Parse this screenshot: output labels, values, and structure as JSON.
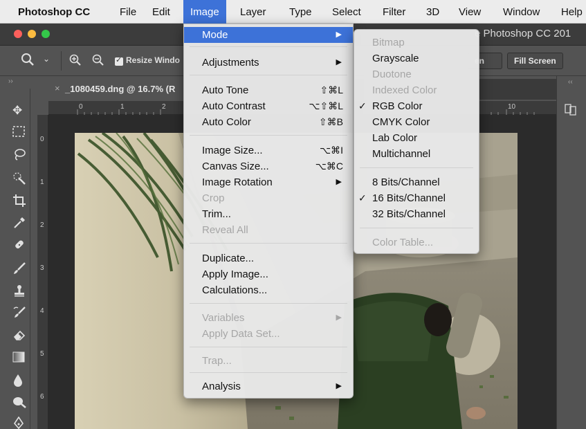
{
  "menubar": {
    "app": "Photoshop CC",
    "items": [
      "File",
      "Edit",
      "Image",
      "Layer",
      "Type",
      "Select",
      "Filter",
      "3D",
      "View",
      "Window",
      "Help"
    ]
  },
  "window": {
    "title": "e Photoshop CC 201"
  },
  "options_bar": {
    "resize_windows_label": "Resize Windo",
    "screen_button": "en",
    "fill_screen_button": "Fill Screen"
  },
  "document": {
    "tab_title": "_1080459.dng @ 16.7% (R"
  },
  "ruler": {
    "h": [
      "0",
      "1",
      "2",
      "10"
    ],
    "v": [
      "0",
      "1",
      "2",
      "3",
      "4",
      "5",
      "6"
    ]
  },
  "image_menu": {
    "mode": "Mode",
    "adjustments": "Adjustments",
    "auto_tone": "Auto Tone",
    "auto_tone_sc": "⇧⌘L",
    "auto_contrast": "Auto Contrast",
    "auto_contrast_sc": "⌥⇧⌘L",
    "auto_color": "Auto Color",
    "auto_color_sc": "⇧⌘B",
    "image_size": "Image Size...",
    "image_size_sc": "⌥⌘I",
    "canvas_size": "Canvas Size...",
    "canvas_size_sc": "⌥⌘C",
    "image_rotation": "Image Rotation",
    "crop": "Crop",
    "trim": "Trim...",
    "reveal_all": "Reveal All",
    "duplicate": "Duplicate...",
    "apply_image": "Apply Image...",
    "calculations": "Calculations...",
    "variables": "Variables",
    "apply_data_set": "Apply Data Set...",
    "trap": "Trap...",
    "analysis": "Analysis"
  },
  "mode_menu": {
    "bitmap": "Bitmap",
    "grayscale": "Grayscale",
    "duotone": "Duotone",
    "indexed_color": "Indexed Color",
    "rgb_color": "RGB Color",
    "cmyk_color": "CMYK Color",
    "lab_color": "Lab Color",
    "multichannel": "Multichannel",
    "bits8": "8 Bits/Channel",
    "bits16": "16 Bits/Channel",
    "bits32": "32 Bits/Channel",
    "color_table": "Color Table...",
    "checkmark": "✓"
  },
  "colors": {
    "highlight": "#3d72d8",
    "menubar": "#ececec",
    "ps_bg": "#535353"
  }
}
